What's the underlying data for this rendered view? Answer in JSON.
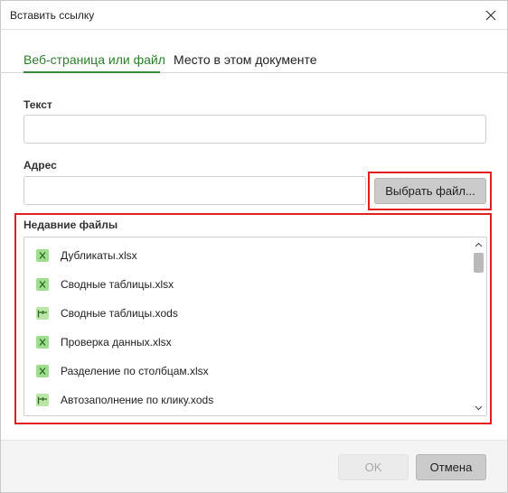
{
  "window": {
    "title": "Вставить ссылку"
  },
  "tabs": [
    {
      "label": "Веб-страница или файл",
      "active": true
    },
    {
      "label": "Место в этом документе",
      "active": false
    }
  ],
  "text_field": {
    "label": "Текст",
    "value": ""
  },
  "address_field": {
    "label": "Адрес",
    "value": ""
  },
  "choose_file_button": {
    "label": "Выбрать файл..."
  },
  "recent_files": {
    "label": "Недавние файлы",
    "items": [
      {
        "name": "Дубликаты.xlsx",
        "icon": "xlsx-file-icon"
      },
      {
        "name": "Сводные таблицы.xlsx",
        "icon": "xlsx-file-icon"
      },
      {
        "name": "Сводные таблицы.xods",
        "icon": "xods-file-icon"
      },
      {
        "name": "Проверка данных.xlsx",
        "icon": "xlsx-file-icon"
      },
      {
        "name": "Разделение по столбцам.xlsx",
        "icon": "xlsx-file-icon"
      },
      {
        "name": "Автозаполнение по клику.xods",
        "icon": "xods-file-icon"
      }
    ]
  },
  "footer": {
    "ok_label": "OK",
    "cancel_label": "Отмена"
  },
  "colors": {
    "accent": "#2d7d2d",
    "highlight": "#e21f1f",
    "xlsx_icon": "#9fde8f",
    "xods_icon": "#b9e5a6"
  }
}
